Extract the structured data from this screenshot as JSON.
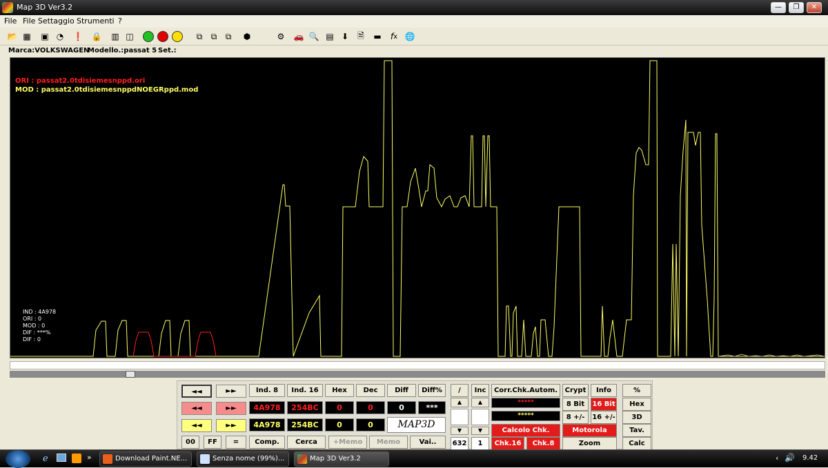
{
  "window": {
    "title": "Map 3D Ver3.2",
    "min_symbol": "—",
    "max_symbol": "❐",
    "close_symbol": "✕"
  },
  "menu": [
    "File",
    "File Settaggio",
    "Strumenti",
    "?"
  ],
  "info": {
    "marca": "Marca:VOLKSWAGEN",
    "modello": "Modello.:passat 5",
    "set": "Set.:"
  },
  "plot": {
    "ori_label": "ORI  : passat2.0tdisiemesnppd.ori",
    "mod_label": "MOD : passat2.0tdisiemesnppdNOEGRppd.mod",
    "ori_color": "#ff2020",
    "mod_color": "#ffff66",
    "stats": [
      "IND : 4A978",
      "ORI : 0",
      "MOD : 0",
      "DIF : ***%",
      "DIF : 0"
    ]
  },
  "panel": {
    "nav_left": "◄◄",
    "nav_right": "►►",
    "headers": [
      "Ind. 8",
      "Ind. 16",
      "Hex",
      "Dec",
      "Diff",
      "Diff%"
    ],
    "row_ori": [
      "4A978",
      "254BC",
      "0",
      "0",
      "0",
      "***"
    ],
    "row_mod": [
      "4A978",
      "254BC",
      "0",
      "0"
    ],
    "logo": "MAP3D",
    "bottom": [
      "00",
      "FF",
      "=",
      "Comp.",
      "Cerca",
      "+Memo",
      "Memo",
      "Vai.."
    ],
    "slash": "/",
    "inc": "Inc",
    "v632": "632",
    "v1": "1",
    "corr": "Corr.Chk.Autom.",
    "stars1": "*****",
    "stars2": "*****",
    "calcolo": "Calcolo Chk.",
    "motorola": "Motorola",
    "chk16": "Chk.16",
    "chk8": "Chk.8",
    "zoom": "Zoom",
    "crypt": "Crypt",
    "info": "Info",
    "bit8": "8 Bit",
    "bit16": "16 Bit",
    "pm8": "8 +/-",
    "pm16": "16 +/-",
    "side": [
      "%",
      "Hex",
      "3D",
      "Tav.",
      "Calc"
    ]
  },
  "taskbar": {
    "tasks": [
      "Download Paint.NE...",
      "Senza nome (99%)...",
      "Map 3D Ver3.2"
    ],
    "clock": "9.42"
  }
}
